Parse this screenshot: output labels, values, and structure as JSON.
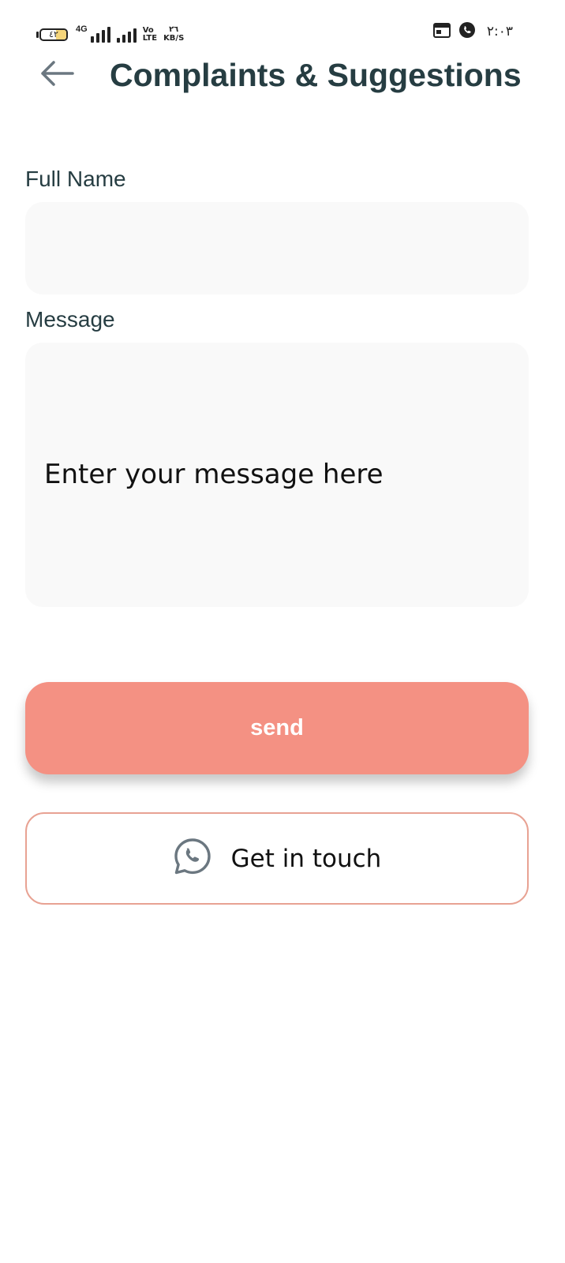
{
  "status_bar": {
    "battery_level": "٤٢",
    "network_type": "4G",
    "volte_top": "Vo",
    "volte_bottom": "LTE",
    "speed_value": "٢٦",
    "speed_unit": "KB/S",
    "time": "٢:٠٣",
    "icons": [
      "battery-icon",
      "signal-icon",
      "signal-icon",
      "calendar-icon",
      "whatsapp-icon"
    ]
  },
  "header": {
    "title": "Complaints & Suggestions",
    "back_icon": "arrow-left-icon"
  },
  "form": {
    "full_name": {
      "label": "Full Name",
      "value": "",
      "placeholder": ""
    },
    "message": {
      "label": "Message",
      "placeholder": "Enter your message here"
    }
  },
  "actions": {
    "send_label": "send",
    "contact_label": "Get in touch",
    "contact_icon": "whatsapp-icon"
  },
  "colors": {
    "accent": "#f49183",
    "outline": "#e8a293",
    "title": "#263d42",
    "field_background": "#f9f9f9"
  }
}
